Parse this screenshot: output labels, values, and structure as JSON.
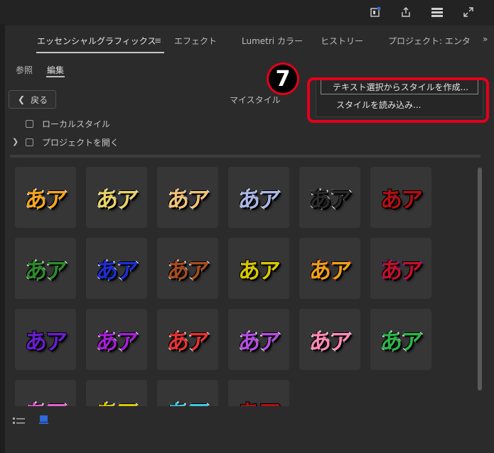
{
  "tabs": [
    {
      "label": "エッセンシャルグラフィックス"
    },
    {
      "label": "エフェクト"
    },
    {
      "label": "Lumetri カラー"
    },
    {
      "label": "ヒストリー"
    },
    {
      "label": "プロジェクト: エンタ"
    }
  ],
  "tab_more_label": "»",
  "subtabs": {
    "browse": "参照",
    "edit": "編集"
  },
  "back_label": "戻る",
  "library_title": "マイスタイル",
  "rows": {
    "local_styles": "ローカルスタイル",
    "open_project": "プロジェクトを開く"
  },
  "menu": {
    "create_from_selection": "テキスト選択からスタイルを作成...",
    "import_styles": "スタイルを読み込み..."
  },
  "callout_number": "7",
  "style_preview_text": "あア",
  "style_tiles": [
    {
      "fill": "#f5a623",
      "stroke": "#ffffff"
    },
    {
      "fill": "#e8d36a",
      "stroke": "#ffffff"
    },
    {
      "fill": "#f2c27a",
      "stroke": "#ffffff"
    },
    {
      "fill": "#aab6e6",
      "stroke": "#ffffff"
    },
    {
      "fill": "#2a2a2a",
      "stroke": "#ffffff"
    },
    {
      "fill": "#b10f14",
      "stroke": "#000000"
    },
    {
      "fill": "#2d8b2d",
      "stroke": "#ffffff"
    },
    {
      "fill": "#1c2fd6",
      "stroke": "#ffffff"
    },
    {
      "fill": "#a64d1f",
      "stroke": "#ffffff"
    },
    {
      "fill": "#d8c800",
      "stroke": "#000000"
    },
    {
      "fill": "#f0a01a",
      "stroke": "#e23636"
    },
    {
      "fill": "#c4102c",
      "stroke": "#6a2bd8"
    },
    {
      "fill": "#6a1fcf",
      "stroke": "#000000"
    },
    {
      "fill": "#a51fd6",
      "stroke": "#ffffff"
    },
    {
      "fill": "#e63232",
      "stroke": "#ffffff"
    },
    {
      "fill": "#b44ee0",
      "stroke": "#ffffff"
    },
    {
      "fill": "#ff89b5",
      "stroke": "#ffffff"
    },
    {
      "fill": "#2bb54a",
      "stroke": "#ffffff"
    },
    {
      "fill": "#e45fd0",
      "stroke": "#ffffff"
    },
    {
      "fill": "#d8c800",
      "stroke": "#ffffff"
    },
    {
      "fill": "#3fc7e0",
      "stroke": "#ffffff"
    },
    {
      "fill": "#b10f14",
      "stroke": "#000000"
    }
  ],
  "accent_color": "#2d6ad6",
  "highlight_color": "#e3001b"
}
